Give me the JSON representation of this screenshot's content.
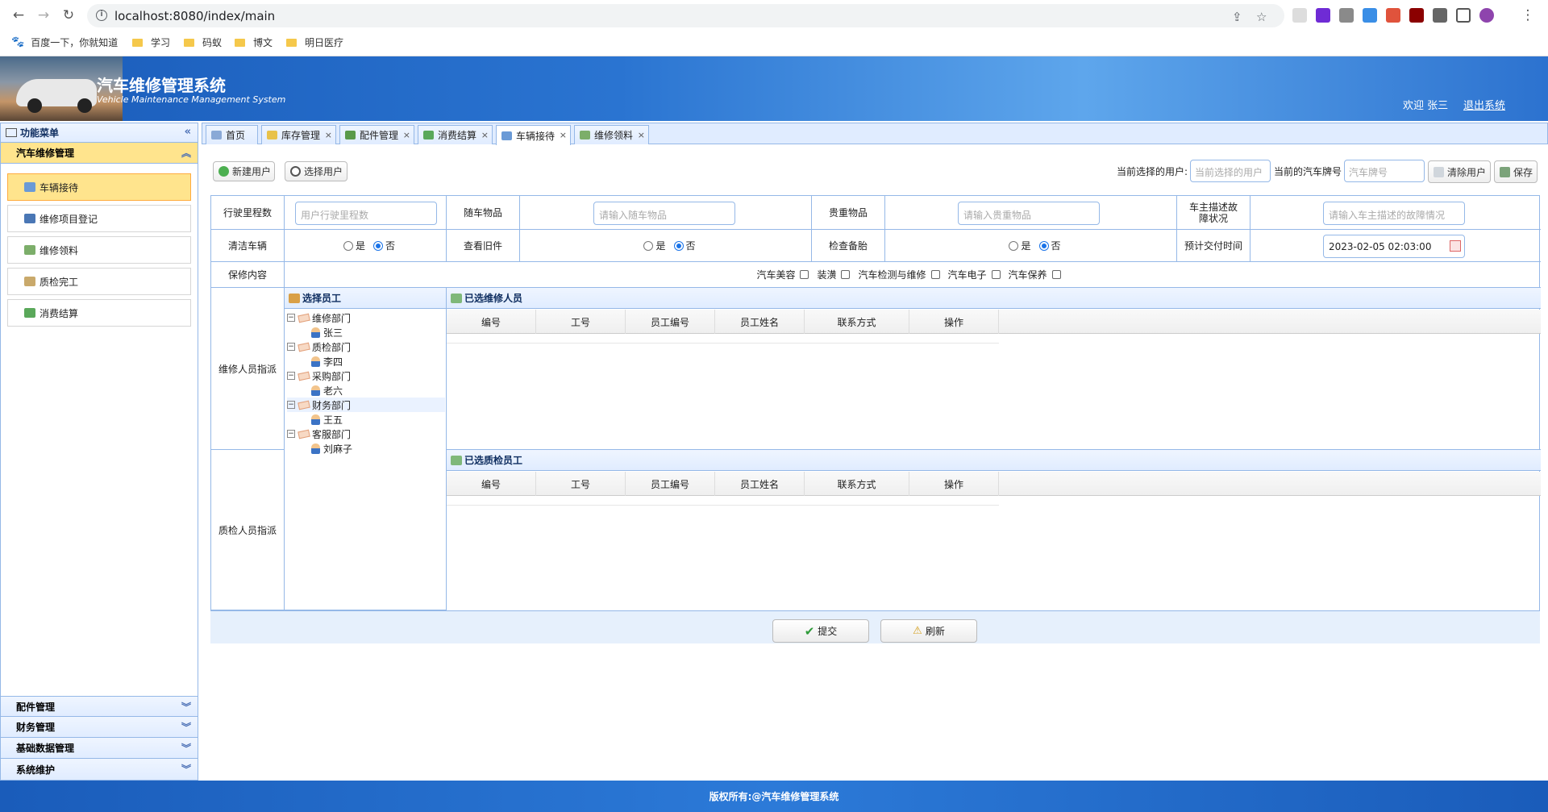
{
  "browser": {
    "url": "localhost:8080/index/main",
    "bookmarks": [
      "百度一下，你就知道",
      "学习",
      "码蚁",
      "博文",
      "明日医疗"
    ]
  },
  "header": {
    "title": "汽车维修管理系统",
    "subtitle": "Vehicle Maintenance Management System",
    "welcome": "欢迎 张三",
    "logout": "退出系统"
  },
  "sidebar": {
    "title": "功能菜单",
    "active_group": "汽车维修管理",
    "items": [
      "车辆接待",
      "维修项目登记",
      "维修领料",
      "质检完工",
      "消费结算"
    ],
    "groups": [
      "配件管理",
      "财务管理",
      "基础数据管理",
      "系统维护"
    ]
  },
  "tabs": [
    {
      "label": "首页",
      "closable": false
    },
    {
      "label": "库存管理",
      "closable": true
    },
    {
      "label": "配件管理",
      "closable": true
    },
    {
      "label": "消费结算",
      "closable": true
    },
    {
      "label": "车辆接待",
      "closable": true,
      "active": true
    },
    {
      "label": "维修领料",
      "closable": true
    }
  ],
  "toolbar": {
    "new_user": "新建用户",
    "select_user": "选择用户",
    "current_user_label": "当前选择的用户:",
    "current_user_placeholder": "当前选择的用户",
    "plate_label": "当前的汽车牌号",
    "plate_placeholder": "汽车牌号",
    "clear_user": "清除用户",
    "save": "保存"
  },
  "form": {
    "mileage_label": "行驶里程数",
    "mileage_placeholder": "用户行驶里程数",
    "carry_items_label": "随车物品",
    "carry_items_placeholder": "请输入随车物品",
    "valuables_label": "贵重物品",
    "valuables_placeholder": "请输入贵重物品",
    "fault_desc_label": "车主描述故障状况",
    "fault_desc_placeholder": "请输入车主描述的故障情况",
    "wash_label": "清洁车辆",
    "old_parts_label": "查看旧件",
    "spare_tire_label": "检查备胎",
    "yes": "是",
    "no": "否",
    "delivery_label": "预计交付时间",
    "delivery_value": "2023-02-05 02:03:00",
    "maintain_label": "保修内容",
    "maintain_options": [
      "汽车美容",
      "装潢",
      "汽车检测与维修",
      "汽车电子",
      "汽车保养"
    ],
    "repair_assign_label": "维修人员指派",
    "qc_assign_label": "质检人员指派"
  },
  "employee_tree": {
    "title": "选择员工",
    "departments": [
      {
        "name": "维修部门",
        "staff": [
          "张三"
        ]
      },
      {
        "name": "质检部门",
        "staff": [
          "李四"
        ]
      },
      {
        "name": "采购部门",
        "staff": [
          "老六"
        ]
      },
      {
        "name": "财务部门",
        "staff": [
          "王五"
        ],
        "highlighted": true
      },
      {
        "name": "客服部门",
        "staff": [
          "刘麻子"
        ]
      }
    ]
  },
  "repair_staff_panel": {
    "title": "已选维修人员",
    "columns": [
      "编号",
      "工号",
      "员工编号",
      "员工姓名",
      "联系方式",
      "操作"
    ]
  },
  "qc_staff_panel": {
    "title": "已选质检员工",
    "columns": [
      "编号",
      "工号",
      "员工编号",
      "员工姓名",
      "联系方式",
      "操作"
    ]
  },
  "actions": {
    "submit": "提交",
    "refresh": "刷新"
  },
  "footer": {
    "copyright": "版权所有:@汽车维修管理系统"
  }
}
